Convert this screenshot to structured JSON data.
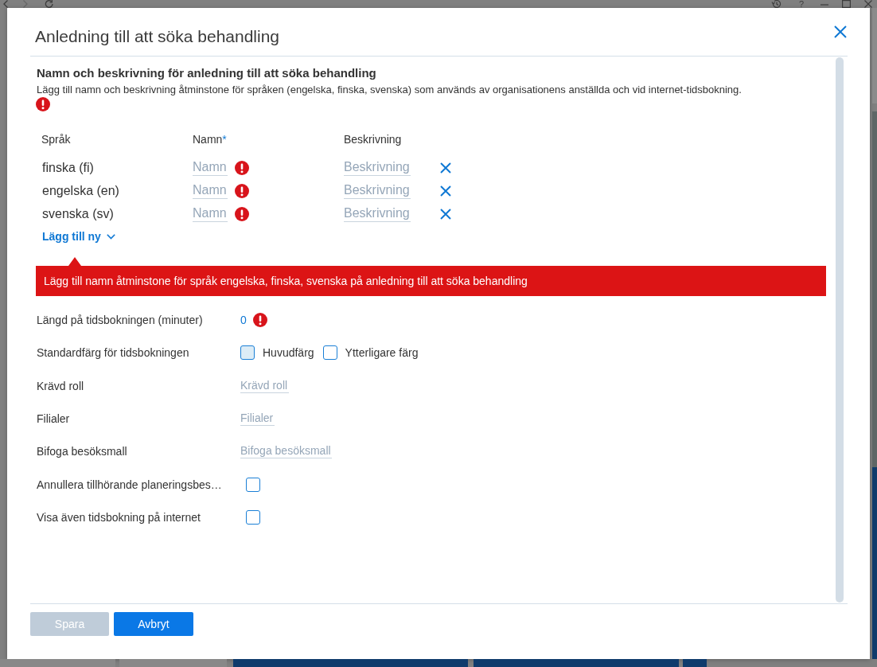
{
  "app_toolbar": {
    "help": "?"
  },
  "dialog": {
    "title": "Anledning till att söka behandling"
  },
  "name_section": {
    "heading": "Namn och beskrivning för anledning till att söka behandling",
    "description": "Lägg till namn och beskrivning åtminstone för språken (engelska, finska, svenska) som används av organisationens anställda och vid internet-tidsbokning.",
    "error": true
  },
  "language_table": {
    "columns": [
      {
        "label": "Språk"
      },
      {
        "label": "Namn",
        "required_mark": "*"
      },
      {
        "label": "Beskrivning"
      }
    ],
    "rows": [
      {
        "language": "finska (fi)",
        "name_placeholder": "Namn",
        "name_error": true,
        "description_placeholder": "Beskrivning"
      },
      {
        "language": "engelska (en)",
        "name_placeholder": "Namn",
        "name_error": true,
        "description_placeholder": "Beskrivning"
      },
      {
        "language": "svenska (sv)",
        "name_placeholder": "Namn",
        "name_error": true,
        "description_placeholder": "Beskrivning"
      }
    ],
    "add_button": "Lägg till ny"
  },
  "error_banner": {
    "message": "Lägg till namn åtminstone för språk engelska, finska, svenska på anledning till att söka behandling"
  },
  "fields": [
    {
      "kind": "number",
      "label": "Längd på tidsbokningen (minuter)",
      "value": "0",
      "error": true
    },
    {
      "kind": "colors",
      "label": "Standardfärg för tidsbokningen",
      "options": [
        {
          "label": "Huvudfärg",
          "color": "#dcecf6"
        },
        {
          "label": "Ytterligare färg",
          "color": "#ffffff"
        }
      ]
    },
    {
      "kind": "picker",
      "label": "Krävd roll",
      "placeholder": "Krävd roll"
    },
    {
      "kind": "picker",
      "label": "Filialer",
      "placeholder": "Filialer"
    },
    {
      "kind": "picker",
      "label": "Bifoga besöksmall",
      "placeholder": "Bifoga besöksmall"
    },
    {
      "kind": "checkbox",
      "label": "Annullera tillhörande planeringsbes…",
      "checked": false
    },
    {
      "kind": "checkbox",
      "label": "Visa även tidsbokning på internet",
      "checked": false
    }
  ],
  "buttons": [
    {
      "label": "Spara",
      "disabled": true
    },
    {
      "label": "Avbryt",
      "disabled": false
    }
  ]
}
